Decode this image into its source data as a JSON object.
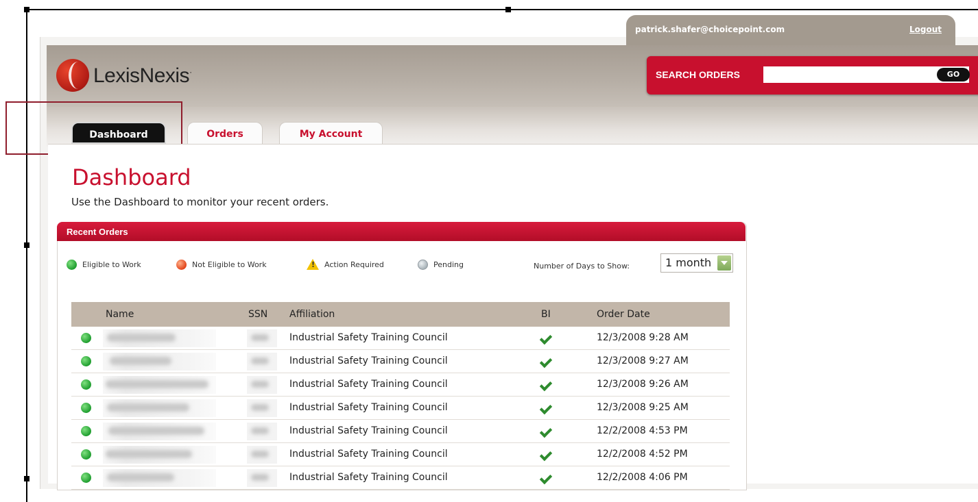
{
  "user": {
    "email": "patrick.shafer@choicepoint.com",
    "logout_label": "Logout"
  },
  "brand": {
    "name": "LexisNexis",
    "mark": "·"
  },
  "search": {
    "label": "SEARCH ORDERS",
    "placeholder": "",
    "go_label": "GO"
  },
  "tabs": [
    {
      "label": "Dashboard",
      "active": true
    },
    {
      "label": "Orders",
      "active": false
    },
    {
      "label": "My Account",
      "active": false
    }
  ],
  "page": {
    "title": "Dashboard",
    "subtitle": "Use the Dashboard to monitor your recent orders."
  },
  "panel": {
    "title": "Recent Orders",
    "legend": [
      {
        "icon": "green-circle-icon",
        "label": "Eligible to Work"
      },
      {
        "icon": "red-circle-icon",
        "label": "Not Eligible to Work"
      },
      {
        "icon": "warning-icon",
        "label": "Action Required"
      },
      {
        "icon": "grey-circle-icon",
        "label": "Pending"
      }
    ],
    "days_label": "Number of Days to Show:",
    "days_value": "1 month"
  },
  "table": {
    "columns": [
      "Name",
      "SSN",
      "Affiliation",
      "BI",
      "Order Date"
    ],
    "rows": [
      {
        "status": "eligible",
        "affiliation": "Industrial Safety Training Council",
        "bi": "check",
        "date": "12/3/2008 9:28 AM"
      },
      {
        "status": "eligible",
        "affiliation": "Industrial Safety Training Council",
        "bi": "check",
        "date": "12/3/2008 9:27 AM"
      },
      {
        "status": "eligible",
        "affiliation": "Industrial Safety Training Council",
        "bi": "check",
        "date": "12/3/2008 9:26 AM"
      },
      {
        "status": "eligible",
        "affiliation": "Industrial Safety Training Council",
        "bi": "check",
        "date": "12/3/2008 9:25 AM"
      },
      {
        "status": "eligible",
        "affiliation": "Industrial Safety Training Council",
        "bi": "check",
        "date": "12/2/2008 4:53 PM"
      },
      {
        "status": "eligible",
        "affiliation": "Industrial Safety Training Council",
        "bi": "check",
        "date": "12/2/2008 4:52 PM"
      },
      {
        "status": "eligible",
        "affiliation": "Industrial Safety Training Council",
        "bi": "check",
        "date": "12/2/2008 4:06 PM"
      }
    ]
  },
  "colors": {
    "brand_red": "#c8102e",
    "header_taupe": "#a59c92",
    "table_header": "#c2b6a9",
    "eligible_green": "#1f9e2f"
  }
}
